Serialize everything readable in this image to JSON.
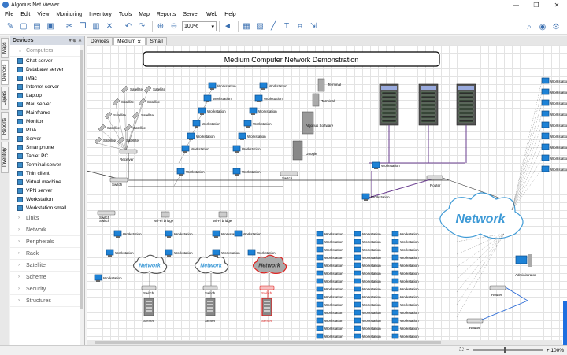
{
  "window": {
    "title": "Algorius Net Viewer",
    "min": "—",
    "max": "❐",
    "close": "✕"
  },
  "menu": [
    "File",
    "Edit",
    "View",
    "Monitoring",
    "Inventory",
    "Tools",
    "Map",
    "Reports",
    "Server",
    "Web",
    "Help"
  ],
  "toolbar": {
    "zoom": "100%"
  },
  "vertical_tabs": [
    "Maps",
    "Devices",
    "Layers",
    "Reports",
    "Inventory"
  ],
  "panel": {
    "title": "Devices",
    "open_category": "Computers",
    "items": [
      "Chat server",
      "Database server",
      "iMac",
      "Internet server",
      "Laptop",
      "Mail server",
      "Mainframe",
      "Monitor",
      "PDA",
      "Server",
      "Smartphone",
      "Tablet PC",
      "Terminal server",
      "Thin client",
      "Virtual machine",
      "VPN server",
      "Workstation",
      "Workstation small"
    ],
    "categories": [
      "Links",
      "Network",
      "Peripherals",
      "Rack",
      "Satellite",
      "Scheme",
      "Security",
      "Structures"
    ]
  },
  "doc_tabs": [
    "Devices",
    "Medium",
    "Small"
  ],
  "diagram": {
    "title": "Medium Computer Network Demonstration",
    "labels": {
      "satellite": "Satellite",
      "receiver": "Receiver",
      "switch": "Switch",
      "workstation": "Workstation",
      "terminal": "Terminal",
      "algorius_software": "Algorius Software",
      "google": "Google",
      "router": "Router",
      "wifi": "Wi-Fi bridge",
      "network": "Network",
      "server": "Server",
      "administrator": "Administrator"
    }
  },
  "status": {
    "zoom": "100%"
  }
}
